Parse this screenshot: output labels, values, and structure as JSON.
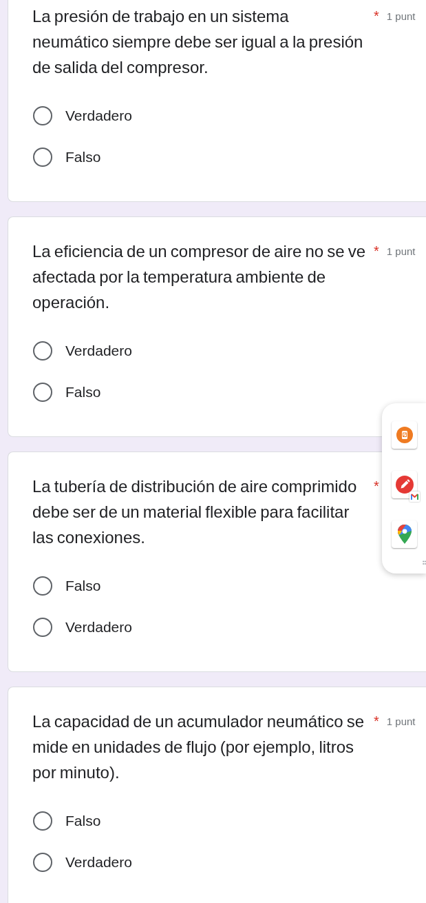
{
  "questions": [
    {
      "title": "La presión de trabajo en un sistema neumático siempre debe ser igual a la presión de salida del compresor.",
      "required_mark": "*",
      "points": "1 punt",
      "options": [
        {
          "label": "Verdadero",
          "selected": false
        },
        {
          "label": "Falso",
          "selected": false
        }
      ]
    },
    {
      "title": "La eficiencia de un compresor de aire no se ve afectada por la temperatura ambiente de operación.",
      "required_mark": "*",
      "points": "1 punt",
      "options": [
        {
          "label": "Verdadero",
          "selected": false
        },
        {
          "label": "Falso",
          "selected": false
        }
      ]
    },
    {
      "title": "La tubería de distribución de aire comprimido debe ser de un material flexible para facilitar las conexiones.",
      "required_mark": "*",
      "options": [
        {
          "label": "Falso",
          "selected": false
        },
        {
          "label": "Verdadero",
          "selected": false
        }
      ]
    },
    {
      "title": "La capacidad de un acumulador neumático se mide en unidades de flujo (por ejemplo, litros por minuto).",
      "required_mark": "*",
      "points": "1 punt",
      "options": [
        {
          "label": "Falso",
          "selected": false
        },
        {
          "label": "Verdadero",
          "selected": false
        }
      ]
    }
  ]
}
